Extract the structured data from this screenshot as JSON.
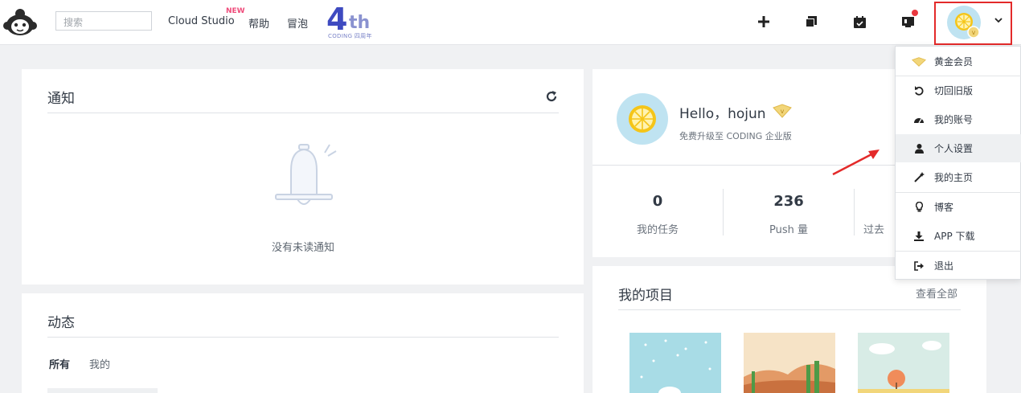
{
  "header": {
    "search_placeholder": "搜索",
    "nav": {
      "cloud_studio": "Cloud Studio",
      "new_badge": "NEW",
      "help": "帮助",
      "bubble": "冒泡"
    },
    "anniversary": {
      "number": "4",
      "suffix": "th",
      "caption": "CODING 四周年"
    },
    "icons": [
      "plus-icon",
      "copy-icon",
      "calendar-check-icon",
      "notification-icon"
    ],
    "notification_dot_color": "#e9383f"
  },
  "notifications": {
    "title": "通知",
    "empty_text": "没有未读通知"
  },
  "activity": {
    "title": "动态",
    "tabs": [
      "所有",
      "我的"
    ]
  },
  "profile": {
    "greeting": "Hello，hojun",
    "upgrade_text": "免费升级至 CODING 企业版",
    "stats": [
      {
        "value": "0",
        "label": "我的任务"
      },
      {
        "value": "236",
        "label": "Push 量"
      },
      {
        "value": "",
        "label": "过去"
      }
    ]
  },
  "projects": {
    "title": "我的项目",
    "view_all": "查看全部"
  },
  "dropdown": {
    "items": [
      {
        "label": "黄金会员",
        "icon": "gold-member-icon"
      },
      {
        "label": "切回旧版",
        "icon": "undo-icon"
      },
      {
        "label": "我的账号",
        "icon": "dashboard-icon"
      },
      {
        "label": "个人设置",
        "icon": "user-icon"
      },
      {
        "label": "我的主页",
        "icon": "magic-wand-icon"
      },
      {
        "label": "博客",
        "icon": "lightbulb-icon"
      },
      {
        "label": "APP 下载",
        "icon": "download-icon"
      },
      {
        "label": "退出",
        "icon": "sign-out-icon"
      }
    ]
  },
  "colors": {
    "highlight_border": "#e32a2a",
    "brand": "#3e4ac0",
    "new_badge": "#ef4b7a"
  }
}
